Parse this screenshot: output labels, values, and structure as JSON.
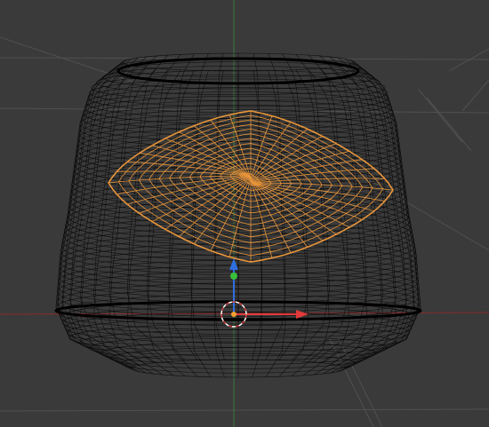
{
  "viewport": {
    "background": "#3a3a3a",
    "colors": {
      "grid": "#474747",
      "grid_major": "#505050",
      "x_axis": "#8a2a2a",
      "y_axis": "#3d7a3d",
      "outer_mesh": "#000000",
      "selected_mesh": "#e8953a",
      "gizmo_x": "#e03a3a",
      "gizmo_y": "#3ac03a",
      "gizmo_z": "#2f6fe0",
      "cursor": "#ffffff",
      "origin": "#f0a030"
    }
  },
  "objects": [
    {
      "name": "outer-mesh",
      "selected": false
    },
    {
      "name": "inner-cap-mesh",
      "selected": true
    }
  ],
  "gizmo": {
    "type": "translate",
    "axes": [
      "x",
      "y",
      "z"
    ]
  },
  "icons": [
    "3d-cursor-icon",
    "origin-dot-icon",
    "translate-gizmo-icon"
  ]
}
